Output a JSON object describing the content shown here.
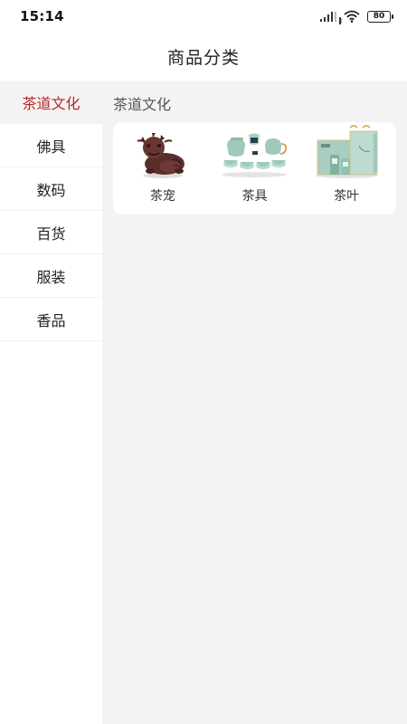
{
  "status_bar": {
    "time": "15:14",
    "battery": "80",
    "icons": [
      "signal-icon",
      "wifi-icon",
      "battery-icon"
    ]
  },
  "header": {
    "title": "商品分类"
  },
  "sidebar": {
    "items": [
      {
        "label": "茶道文化",
        "active": true
      },
      {
        "label": "佛具",
        "active": false
      },
      {
        "label": "数码",
        "active": false
      },
      {
        "label": "百货",
        "active": false
      },
      {
        "label": "服装",
        "active": false
      },
      {
        "label": "香品",
        "active": false
      }
    ]
  },
  "main": {
    "section_title": "茶道文化",
    "products": [
      {
        "label": "茶宠",
        "icon": "tea-pet-image"
      },
      {
        "label": "茶具",
        "icon": "tea-set-image"
      },
      {
        "label": "茶叶",
        "icon": "tea-leaf-box-image"
      }
    ]
  },
  "colors": {
    "accent": "#b5262c",
    "content_bg": "#f3f3f3",
    "card_bg": "#ffffff"
  }
}
